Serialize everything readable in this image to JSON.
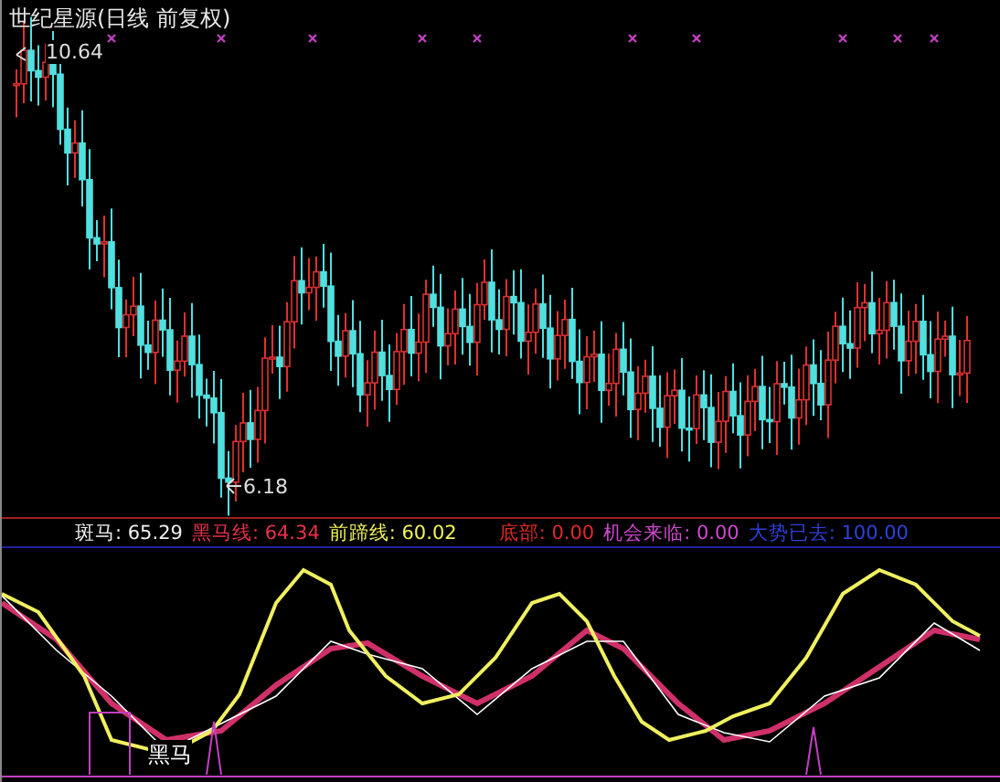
{
  "title": "世纪星源(日线 前复权)",
  "price_high": "10.64",
  "price_low": "6.18",
  "indicators": [
    {
      "label": "斑马:",
      "value": "65.29"
    },
    {
      "label": "黑马线:",
      "value": "64.34"
    },
    {
      "label": "前蹄线:",
      "value": "60.02"
    },
    {
      "label": "底部:",
      "value": "0.00"
    },
    {
      "label": "机会来临:",
      "value": "0.00"
    },
    {
      "label": "大势已去:",
      "value": "100.00"
    }
  ],
  "signal_label": "黑马"
}
